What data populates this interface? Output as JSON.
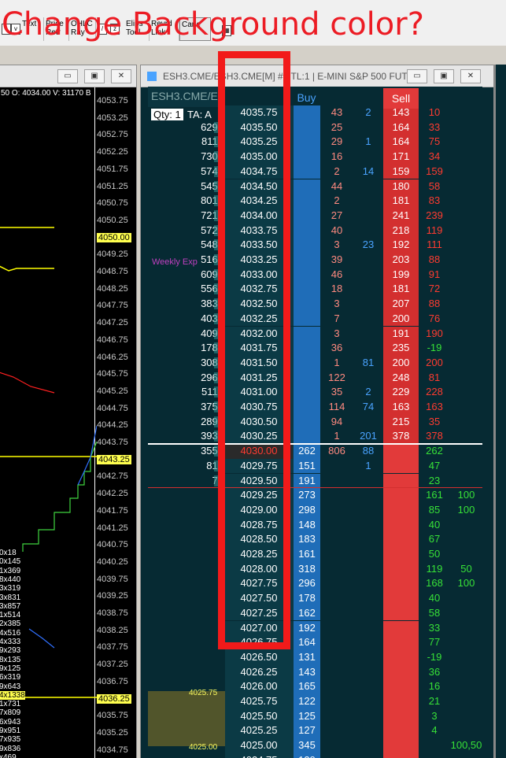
{
  "annotation": {
    "headline": "Change Background color?"
  },
  "toolbar": {
    "buttons": [
      {
        "label": "Text",
        "sub": ""
      },
      {
        "label": "Price",
        "sub": "Retr"
      },
      {
        "label": "OHLC",
        "sub": "Ray"
      },
      {
        "label": "Elips",
        "sub": "Tool"
      },
      {
        "label": "Revrd",
        "sub": "Link"
      },
      {
        "label": "Cane",
        "sub": ""
      }
    ]
  },
  "left_window": {
    "ohlc_text": "50 O: 4034.00 V: 31170 B",
    "y_labels": [
      "4053.75",
      "4053.25",
      "4052.75",
      "4052.25",
      "4051.75",
      "4051.25",
      "4050.75",
      "4050.25",
      "4050.00",
      "4049.25",
      "4048.75",
      "4048.25",
      "4047.75",
      "4047.25",
      "4046.75",
      "4046.25",
      "4045.75",
      "4045.25",
      "4044.75",
      "4044.25",
      "4043.75",
      "4043.25",
      "4042.75",
      "4042.25",
      "4041.75",
      "4041.25",
      "4040.75",
      "4040.25",
      "4039.75",
      "4039.25",
      "4038.75",
      "4038.25",
      "4037.75",
      "4037.25",
      "4036.75",
      "4036.25",
      "4035.75",
      "4035.25",
      "4034.75"
    ],
    "highlighted": [
      "4050.00",
      "4043.25",
      "4036.25"
    ],
    "bar_labels": [
      "0x18",
      "0x145",
      "1x369",
      "8x440",
      "3x319",
      "3x831",
      "3x857",
      "1x514",
      "2x385",
      "4x516",
      "4x333",
      "9x293",
      "8x135",
      "9x125",
      "6x319",
      "9x643",
      "4x1338",
      "1x731",
      "7x809",
      "6x943",
      "9x951",
      "7x935",
      "9x836",
      "x469"
    ],
    "annotation_text": "Weekly Exp"
  },
  "right_window": {
    "title": "ESH3.CME/ESH3.CME[M]  #1 TL:1 | E-MINI S&P 500 FUT...",
    "symbol_label": "ESH3.CME/E",
    "qty_label": "Qty: 1",
    "ta_label": "TA: A",
    "buy_label": "Buy",
    "sell_label": "Sell",
    "vp_high": "4025.75",
    "vp_low": "4025.00"
  },
  "ladder": {
    "current_price": "4030.00",
    "rows": [
      {
        "vol": "",
        "price": "4035.75",
        "buy": "",
        "bid": "43",
        "ask": "2",
        "sell": "143",
        "pnl": "10",
        "ext": ""
      },
      {
        "vol": "6295",
        "price": "4035.50",
        "buy": "",
        "bid": "25",
        "ask": "",
        "sell": "164",
        "pnl": "33",
        "ext": ""
      },
      {
        "vol": "8117",
        "price": "4035.25",
        "buy": "",
        "bid": "29",
        "ask": "1",
        "sell": "164",
        "pnl": "75",
        "ext": ""
      },
      {
        "vol": "7306",
        "price": "4035.00",
        "buy": "",
        "bid": "16",
        "ask": "",
        "sell": "171",
        "pnl": "34",
        "ext": ""
      },
      {
        "vol": "5741",
        "price": "4034.75",
        "buy": "",
        "bid": "2",
        "ask": "14",
        "sell": "159",
        "pnl": "159",
        "ext": ""
      },
      {
        "vol": "5459",
        "price": "4034.50",
        "buy": "",
        "bid": "44",
        "ask": "",
        "sell": "180",
        "pnl": "58",
        "ext": ""
      },
      {
        "vol": "8010",
        "price": "4034.25",
        "buy": "",
        "bid": "2",
        "ask": "",
        "sell": "181",
        "pnl": "83",
        "ext": ""
      },
      {
        "vol": "7214",
        "price": "4034.00",
        "buy": "",
        "bid": "27",
        "ask": "",
        "sell": "241",
        "pnl": "239",
        "ext": ""
      },
      {
        "vol": "5726",
        "price": "4033.75",
        "buy": "",
        "bid": "40",
        "ask": "",
        "sell": "218",
        "pnl": "119",
        "ext": ""
      },
      {
        "vol": "5481",
        "price": "4033.50",
        "buy": "",
        "bid": "3",
        "ask": "23",
        "sell": "192",
        "pnl": "111",
        "ext": ""
      },
      {
        "vol": "5167",
        "price": "4033.25",
        "buy": "",
        "bid": "39",
        "ask": "",
        "sell": "203",
        "pnl": "88",
        "ext": ""
      },
      {
        "vol": "6092",
        "price": "4033.00",
        "buy": "",
        "bid": "46",
        "ask": "",
        "sell": "199",
        "pnl": "91",
        "ext": ""
      },
      {
        "vol": "5563",
        "price": "4032.75",
        "buy": "",
        "bid": "18",
        "ask": "",
        "sell": "181",
        "pnl": "72",
        "ext": ""
      },
      {
        "vol": "3830",
        "price": "4032.50",
        "buy": "",
        "bid": "3",
        "ask": "",
        "sell": "207",
        "pnl": "88",
        "ext": ""
      },
      {
        "vol": "4033",
        "price": "4032.25",
        "buy": "",
        "bid": "7",
        "ask": "",
        "sell": "200",
        "pnl": "76",
        "ext": ""
      },
      {
        "vol": "4090",
        "price": "4032.00",
        "buy": "",
        "bid": "3",
        "ask": "",
        "sell": "191",
        "pnl": "190",
        "ext": ""
      },
      {
        "vol": "1789",
        "price": "4031.75",
        "buy": "",
        "bid": "36",
        "ask": "",
        "sell": "235",
        "pnl": "-19",
        "ext": ""
      },
      {
        "vol": "3083",
        "price": "4031.50",
        "buy": "",
        "bid": "1",
        "ask": "81",
        "sell": "200",
        "pnl": "200",
        "ext": ""
      },
      {
        "vol": "2962",
        "price": "4031.25",
        "buy": "",
        "bid": "122",
        "ask": "",
        "sell": "248",
        "pnl": "81",
        "ext": ""
      },
      {
        "vol": "5116",
        "price": "4031.00",
        "buy": "",
        "bid": "35",
        "ask": "2",
        "sell": "229",
        "pnl": "228",
        "ext": ""
      },
      {
        "vol": "3750",
        "price": "4030.75",
        "buy": "",
        "bid": "114",
        "ask": "74",
        "sell": "163",
        "pnl": "163",
        "ext": ""
      },
      {
        "vol": "2890",
        "price": "4030.50",
        "buy": "",
        "bid": "94",
        "ask": "",
        "sell": "215",
        "pnl": "35",
        "ext": ""
      },
      {
        "vol": "3939",
        "price": "4030.25",
        "buy": "",
        "bid": "1",
        "ask": "201",
        "sell": "378",
        "pnl": "378",
        "ext": ""
      },
      {
        "vol": "3557",
        "price": "4030.00",
        "buy": "262",
        "bid": "806",
        "ask": "88",
        "sell": "",
        "pnl": "262",
        "ext": ""
      },
      {
        "vol": "810",
        "price": "4029.75",
        "buy": "151",
        "bid": "",
        "ask": "1",
        "sell": "",
        "pnl": "47",
        "ext": ""
      },
      {
        "vol": "73",
        "price": "4029.50",
        "buy": "191",
        "bid": "",
        "ask": "",
        "sell": "",
        "pnl": "23",
        "ext": ""
      },
      {
        "vol": "",
        "price": "4029.25",
        "buy": "273",
        "bid": "",
        "ask": "",
        "sell": "",
        "pnl": "161",
        "ext": "100"
      },
      {
        "vol": "",
        "price": "4029.00",
        "buy": "298",
        "bid": "",
        "ask": "",
        "sell": "",
        "pnl": "85",
        "ext": "100"
      },
      {
        "vol": "",
        "price": "4028.75",
        "buy": "148",
        "bid": "",
        "ask": "",
        "sell": "",
        "pnl": "40",
        "ext": ""
      },
      {
        "vol": "",
        "price": "4028.50",
        "buy": "183",
        "bid": "",
        "ask": "",
        "sell": "",
        "pnl": "67",
        "ext": ""
      },
      {
        "vol": "",
        "price": "4028.25",
        "buy": "161",
        "bid": "",
        "ask": "",
        "sell": "",
        "pnl": "50",
        "ext": ""
      },
      {
        "vol": "",
        "price": "4028.00",
        "buy": "318",
        "bid": "",
        "ask": "",
        "sell": "",
        "pnl": "119",
        "ext": "50"
      },
      {
        "vol": "",
        "price": "4027.75",
        "buy": "296",
        "bid": "",
        "ask": "",
        "sell": "",
        "pnl": "168",
        "ext": "100"
      },
      {
        "vol": "",
        "price": "4027.50",
        "buy": "178",
        "bid": "",
        "ask": "",
        "sell": "",
        "pnl": "40",
        "ext": ""
      },
      {
        "vol": "",
        "price": "4027.25",
        "buy": "162",
        "bid": "",
        "ask": "",
        "sell": "",
        "pnl": "58",
        "ext": ""
      },
      {
        "vol": "",
        "price": "4027.00",
        "buy": "192",
        "bid": "",
        "ask": "",
        "sell": "",
        "pnl": "33",
        "ext": ""
      },
      {
        "vol": "",
        "price": "4026.75",
        "buy": "164",
        "bid": "",
        "ask": "",
        "sell": "",
        "pnl": "77",
        "ext": ""
      },
      {
        "vol": "",
        "price": "4026.50",
        "buy": "131",
        "bid": "",
        "ask": "",
        "sell": "",
        "pnl": "-19",
        "ext": ""
      },
      {
        "vol": "",
        "price": "4026.25",
        "buy": "143",
        "bid": "",
        "ask": "",
        "sell": "",
        "pnl": "36",
        "ext": ""
      },
      {
        "vol": "",
        "price": "4026.00",
        "buy": "165",
        "bid": "",
        "ask": "",
        "sell": "",
        "pnl": "16",
        "ext": ""
      },
      {
        "vol": "",
        "price": "4025.75",
        "buy": "122",
        "bid": "",
        "ask": "",
        "sell": "",
        "pnl": "21",
        "ext": ""
      },
      {
        "vol": "",
        "price": "4025.50",
        "buy": "125",
        "bid": "",
        "ask": "",
        "sell": "",
        "pnl": "3",
        "ext": ""
      },
      {
        "vol": "",
        "price": "4025.25",
        "buy": "127",
        "bid": "",
        "ask": "",
        "sell": "",
        "pnl": "4",
        "ext": ""
      },
      {
        "vol": "",
        "price": "4025.00",
        "buy": "345",
        "bid": "",
        "ask": "",
        "sell": "",
        "pnl": "",
        "ext": "100,50"
      },
      {
        "vol": "",
        "price": "4024.75",
        "buy": "139",
        "bid": "",
        "ask": "",
        "sell": "",
        "pnl": "",
        "ext": ""
      }
    ]
  },
  "colors": {
    "sell_red": "#e23a3a",
    "sell_dark": "#b01e1e",
    "buy_blue": "#2f7fd6",
    "ladder_bg": "#062a33",
    "annotation_red": "#f21a1a"
  }
}
